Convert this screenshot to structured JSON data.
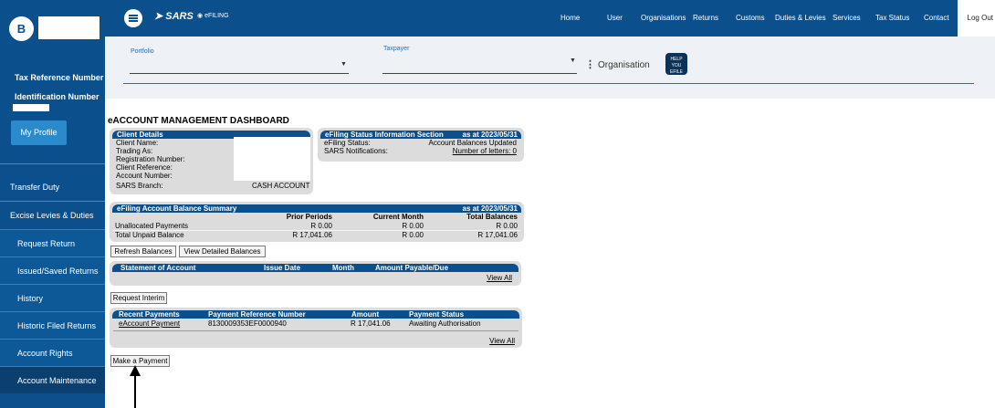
{
  "user": {
    "avatar_initial": "B"
  },
  "sidebar": {
    "tax_ref_label": "Tax Reference Number",
    "id_number_label": "Identification Number",
    "profile_button": "My Profile",
    "items": [
      {
        "label": "Transfer Duty"
      },
      {
        "label": "Excise Levies & Duties"
      },
      {
        "label": "Request Return"
      },
      {
        "label": "Issued/Saved Returns"
      },
      {
        "label": "History"
      },
      {
        "label": "Historic Filed Returns"
      },
      {
        "label": "Account Rights"
      },
      {
        "label": "Account Maintenance"
      }
    ]
  },
  "header": {
    "logo_text": "SARS",
    "efiling_text": "eFILING",
    "nav": [
      "Home",
      "User",
      "Organisations",
      "Returns",
      "Customs",
      "Duties & Levies",
      "Services",
      "Tax Status",
      "Contact",
      "Log Out"
    ]
  },
  "selectors": {
    "portfolio_label": "Portfolio",
    "taxpayer_label": "Taxpayer",
    "organisation_label": "Organisation",
    "help_icon_text": "HELP YOU EFILE"
  },
  "dashboard": {
    "title": "eACCOUNT MANAGEMENT DASHBOARD",
    "client_details": {
      "header": "Client Details",
      "fields": [
        "Client Name:",
        "Trading As:",
        "Registration Number:",
        "Client Reference:",
        "Account Number:",
        "SARS Branch:"
      ],
      "branch_value": "CASH ACCOUNT"
    },
    "status_section": {
      "header": "eFiling Status Information Section",
      "as_at": "as at 2023/05/31",
      "efiling_status_label": "eFiling Status:",
      "efiling_status_value": "Account Balances Updated",
      "notifications_label": "SARS Notifications:",
      "notifications_value": "Number of letters: 0"
    },
    "balance_summary": {
      "header": "eFiling Account Balance Summary",
      "as_at": "as at 2023/05/31",
      "columns": [
        "Prior Periods",
        "Current Month",
        "Total Balances"
      ],
      "rows": [
        {
          "label": "Unallocated Payments",
          "values": [
            "R 0.00",
            "R 0.00",
            "R 0.00"
          ]
        },
        {
          "label": "Total Unpaid Balance",
          "values": [
            "R 17,041.06",
            "R 0.00",
            "R 17,041.06"
          ]
        }
      ]
    },
    "buttons": {
      "refresh": "Refresh Balances",
      "view_detailed": "View Detailed Balances",
      "request_interim": "Request Interim",
      "make_payment": "Make a Payment"
    },
    "statement": {
      "columns": [
        "Statement of Account",
        "Issue Date",
        "Month",
        "Amount Payable/Due"
      ],
      "view_all": "View All"
    },
    "payments": {
      "columns": [
        "Recent Payments",
        "Payment Reference Number",
        "Amount",
        "Payment Status"
      ],
      "rows": [
        {
          "type": "eAccount Payment",
          "reference": "8130009353EF0000940",
          "amount": "R 17,041.06",
          "status": "Awaiting Authorisation"
        }
      ],
      "view_all": "View All"
    }
  }
}
